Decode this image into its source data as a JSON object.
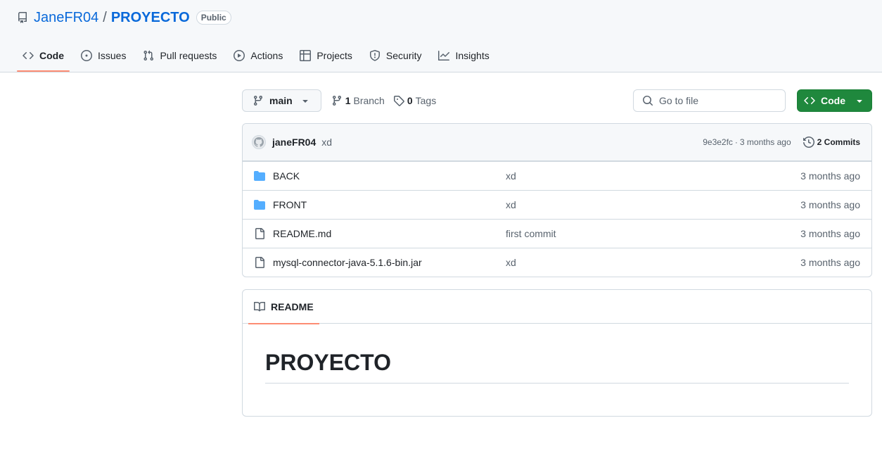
{
  "repo": {
    "owner": "JaneFR04",
    "separator": "/",
    "name": "PROYECTO",
    "visibility": "Public"
  },
  "nav": {
    "tabs": [
      {
        "label": "Code",
        "icon": "code-icon",
        "active": true
      },
      {
        "label": "Issues",
        "icon": "issue-icon"
      },
      {
        "label": "Pull requests",
        "icon": "pull-request-icon"
      },
      {
        "label": "Actions",
        "icon": "play-icon"
      },
      {
        "label": "Projects",
        "icon": "table-icon"
      },
      {
        "label": "Security",
        "icon": "shield-icon"
      },
      {
        "label": "Insights",
        "icon": "graph-icon"
      }
    ]
  },
  "toolbar": {
    "branch": "main",
    "branch_count": "1",
    "branch_label": "Branch",
    "tag_count": "0",
    "tag_label": "Tags",
    "search_placeholder": "Go to file",
    "code_button": "Code"
  },
  "commit": {
    "author": "janeFR04",
    "message": "xd",
    "hash": "9e3e2fc",
    "separator": "·",
    "time": "3 months ago",
    "commits_label": "2 Commits"
  },
  "files": [
    {
      "type": "folder",
      "name": "BACK",
      "message": "xd",
      "date": "3 months ago"
    },
    {
      "type": "folder",
      "name": "FRONT",
      "message": "xd",
      "date": "3 months ago"
    },
    {
      "type": "file",
      "name": "README.md",
      "message": "first commit",
      "date": "3 months ago"
    },
    {
      "type": "file",
      "name": "mysql-connector-java-5.1.6-bin.jar",
      "message": "xd",
      "date": "3 months ago"
    }
  ],
  "readme": {
    "tab_label": "README",
    "heading": "PROYECTO"
  },
  "colors": {
    "accent_link": "#0969da",
    "active_underline": "#fd8c73",
    "primary_button": "#1f883d",
    "folder_icon": "#54aeff"
  }
}
